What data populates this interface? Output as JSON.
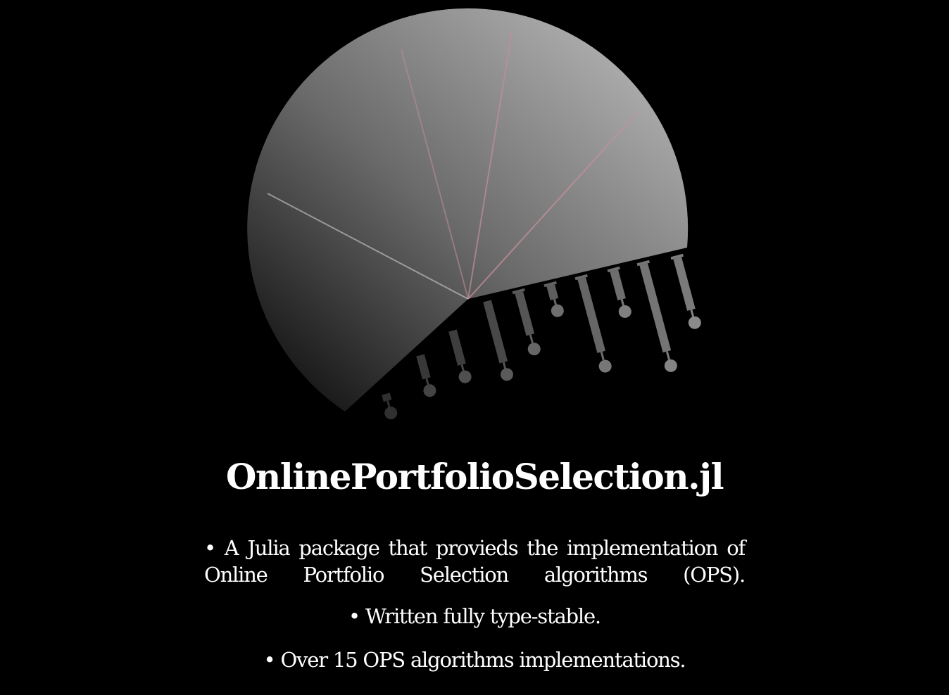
{
  "title": "OnlinePortfolioSelection.jl",
  "bullets": [
    "• A Julia package that provieds the implementation of Online Portfolio Selection algorithms (OPS).",
    "• Written fully type-stable.",
    "• Over 15 OPS algorithms implementations."
  ],
  "logo": {
    "icon": "pie-chart-syringes-logo",
    "colors": {
      "background": "#000000",
      "pie_light": "#b0b0b0",
      "pie_dark": "#1e1e1e",
      "separator": "#c08a90",
      "syringe": "#7a7a7a",
      "text": "#ffffff"
    }
  }
}
